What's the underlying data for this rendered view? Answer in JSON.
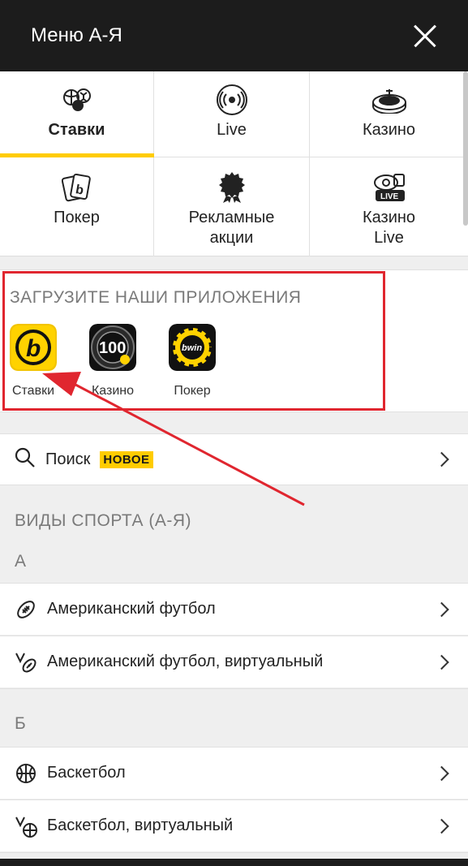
{
  "header": {
    "title": "Меню А-Я"
  },
  "grid": [
    {
      "label": "Ставки",
      "icon": "sports-balls-icon",
      "active": true
    },
    {
      "label": "Live",
      "icon": "live-broadcast-icon",
      "active": false
    },
    {
      "label": "Казино",
      "icon": "roulette-icon",
      "active": false
    },
    {
      "label": "Покер",
      "icon": "poker-cards-icon",
      "active": false
    },
    {
      "label": "Рекламные акции",
      "icon": "promo-badge-icon",
      "active": false
    },
    {
      "label": "Казино Live",
      "icon": "live-casino-icon",
      "active": false
    }
  ],
  "apps": {
    "heading": "ЗАГРУЗИТЕ НАШИ ПРИЛОЖЕНИЯ",
    "items": [
      {
        "name": "Ставки",
        "tile_text": "b"
      },
      {
        "name": "Казино",
        "tile_text": "100"
      },
      {
        "name": "Покер",
        "tile_text": "bwin"
      }
    ]
  },
  "search": {
    "label": "Поиск",
    "badge": "НОВОЕ"
  },
  "sports": {
    "title": "ВИДЫ СПОРТА (А-Я)",
    "groups": [
      {
        "letter": "А",
        "items": [
          {
            "label": "Американский футбол",
            "icon": "american-football-icon"
          },
          {
            "label": "Американский футбол, виртуальный",
            "icon": "virtual-american-football-icon"
          }
        ]
      },
      {
        "letter": "Б",
        "items": [
          {
            "label": "Баскетбол",
            "icon": "basketball-icon"
          },
          {
            "label": "Баскетбол, виртуальный",
            "icon": "virtual-basketball-icon"
          }
        ]
      }
    ]
  },
  "colors": {
    "accent": "#ffcc00",
    "header_bg": "#1c1c1c",
    "highlight": "#e0262f"
  }
}
